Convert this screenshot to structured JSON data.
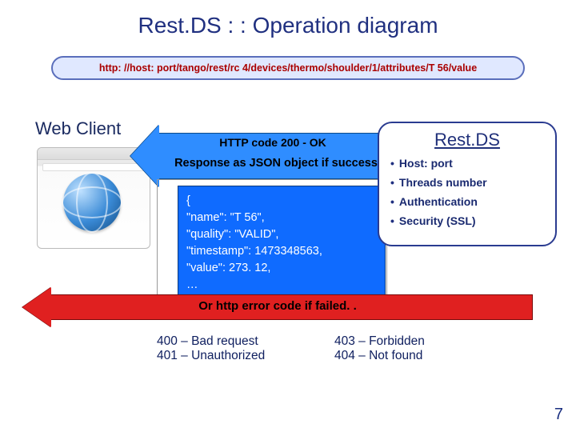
{
  "title": "Rest.DS : : Operation diagram",
  "url": "http: //host: port/tango/rest/rc 4/devices/thermo/shoulder/1/attributes/T 56/value",
  "web_client_label": "Web Client",
  "response": {
    "line1": "HTTP code 200 - OK",
    "line2": "Response as JSON object if success"
  },
  "json_lines": [
    "{",
    "   \"name\": \"T 56\",",
    "   \"quality\": \"VALID\",",
    "   \"timestamp\": 1473348563,",
    "   \"value\": 273. 12,",
    "…",
    "}"
  ],
  "error_banner": "Or http error code if failed. .",
  "errors_left": [
    "400 – Bad request",
    "401 – Unauthorized"
  ],
  "errors_right": [
    "403 – Forbidden",
    "404 – Not found"
  ],
  "restds": {
    "title": "Rest.DS",
    "items": [
      "Host: port",
      "Threads number",
      "Authentication",
      "Security (SSL)"
    ]
  },
  "page_number": "7"
}
